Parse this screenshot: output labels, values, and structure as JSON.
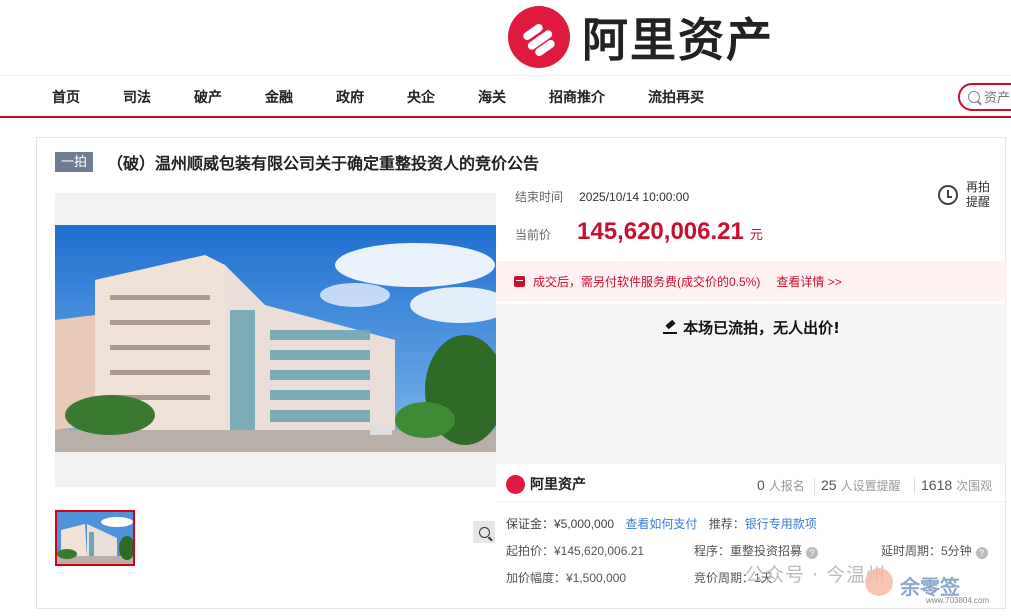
{
  "brand": {
    "name": "阿里资产"
  },
  "nav": {
    "items": [
      "首页",
      "司法",
      "破产",
      "金融",
      "政府",
      "央企",
      "海关",
      "招商推介",
      "流拍再买"
    ],
    "search_placeholder": "资产"
  },
  "auction": {
    "round_tag": "一拍",
    "title": "（破）温州顺威包装有限公司关于确定重整投资人的竞价公告",
    "end_time_label": "结束时间",
    "end_time": "2025/10/14 10:00:00",
    "price_label": "当前价",
    "price": "145,620,006.21",
    "price_unit": "元",
    "remind_label": "再拍提醒",
    "fee_notice": "成交后，需另付软件服务费(成交价的0.5%)",
    "fee_link": "查看详情 >>",
    "status": "本场已流拍，无人出价!",
    "stats": {
      "signups": "0",
      "signups_label": "人报名",
      "reminders": "25",
      "reminders_label": "人设置提醒",
      "views": "1618",
      "views_label": "次围观"
    },
    "details": {
      "deposit": "保证金：¥5,000,000",
      "how_to_pay": "查看如何支付",
      "recommend_label": "推荐：",
      "bank_link": "银行专用款项",
      "start_price": "起拍价：¥145,620,006.21",
      "increment": "加价幅度：¥1,500,000",
      "procedure": "程序：重整投资招募",
      "cycle": "竞价周期：1天",
      "delay": "延时周期：5分钟"
    }
  },
  "watermark": {
    "text": "公众号 · 今温州",
    "site": "www.703804.com",
    "brand": "余零签"
  },
  "colors": {
    "accent": "#c8102e",
    "logo": "#e01a3f",
    "tag": "#6e7c94",
    "link": "#3a7bd5"
  }
}
